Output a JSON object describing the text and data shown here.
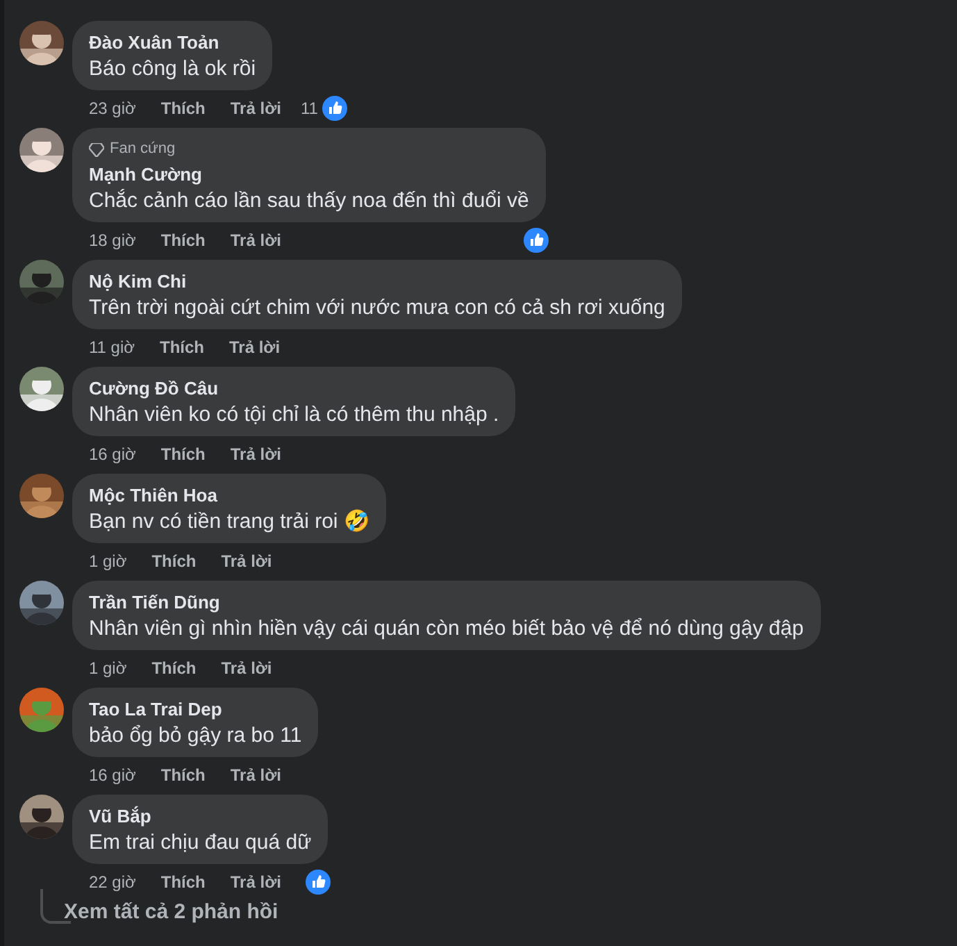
{
  "comments": [
    {
      "name": "Đào Xuân Toản",
      "text": "Báo công là ok rồi",
      "time": "23 giờ",
      "actions": [
        "Thích",
        "Trả lời"
      ],
      "reaction_count": "11",
      "reacted": true
    },
    {
      "badge": "Fan cứng",
      "name": "Mạnh Cường",
      "text": "Chắc cảnh cáo lần sau thấy noa đến thì đuổi về",
      "time": "18 giờ",
      "actions": [
        "Thích",
        "Trả lời"
      ],
      "reacted": true
    },
    {
      "name": "Nộ Kim Chi",
      "text": "Trên trời ngoài cứt chim với nước mưa con có cả sh rơi xuống",
      "time": "11 giờ",
      "actions": [
        "Thích",
        "Trả lời"
      ],
      "reacted": false
    },
    {
      "name": "Cường Đồ Câu",
      "text": "Nhân viên ko có tội chỉ là có thêm thu nhập .",
      "time": "16 giờ",
      "actions": [
        "Thích",
        "Trả lời"
      ],
      "reacted": false
    },
    {
      "name": "Mộc Thiên Hoa",
      "text": "Bạn nv có tiền trang trải roi 🤣",
      "time": "1 giờ",
      "actions": [
        "Thích",
        "Trả lời"
      ],
      "reacted": false
    },
    {
      "name": "Trần Tiến Dũng",
      "text": "Nhân viên gì nhìn hiền vậy cái quán còn méo biết bảo vệ để nó dùng gậy đập",
      "time": "1 giờ",
      "actions": [
        "Thích",
        "Trả lời"
      ],
      "reacted": false
    },
    {
      "name": "Tao La Trai Dep",
      "text": "bảo ổg bỏ gậy ra bo 11",
      "time": "16 giờ",
      "actions": [
        "Thích",
        "Trả lời"
      ],
      "reacted": false
    },
    {
      "name": "Vũ Bắp",
      "text": "Em trai chịu đau quá dữ",
      "time": "22 giờ",
      "actions": [
        "Thích",
        "Trả lời"
      ],
      "reacted": true,
      "replies_link": "Xem tất cả 2 phản hồi"
    }
  ]
}
